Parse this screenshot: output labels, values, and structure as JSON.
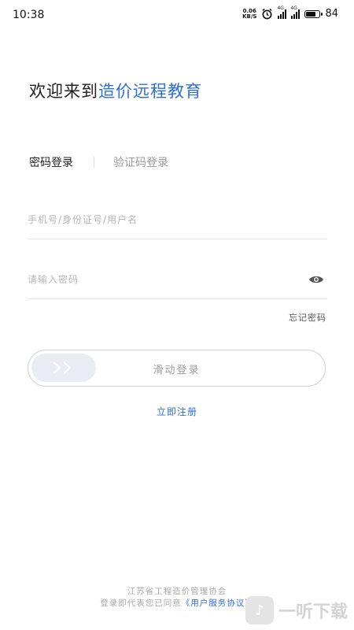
{
  "status_bar": {
    "time": "10:38",
    "net_speed_value": "0.06",
    "net_speed_unit": "KB/S",
    "signal1_label": "4G",
    "signal2_label": "4G",
    "battery_level": "84"
  },
  "welcome": {
    "prefix": "欢迎来到",
    "app_name": "造价远程教育"
  },
  "tabs": [
    {
      "label": "密码登录",
      "active": true
    },
    {
      "label": "验证码登录",
      "active": false
    }
  ],
  "form": {
    "account_placeholder": "手机号/身份证号/用户名",
    "account_value": "",
    "password_placeholder": "请输入密码",
    "password_value": "",
    "forgot_label": "忘记密码"
  },
  "slider": {
    "label": "滑动登录",
    "progress": 0
  },
  "register_label": "立即注册",
  "footer": {
    "org": "江苏省工程造价管理协会",
    "agree_text": "登录即代表您已同意",
    "agreement_link": "《用户服务协议》"
  },
  "watermark": {
    "text": "一听下载"
  },
  "colors": {
    "accent": "#2f6fd8",
    "placeholder": "#b5b5b5"
  }
}
